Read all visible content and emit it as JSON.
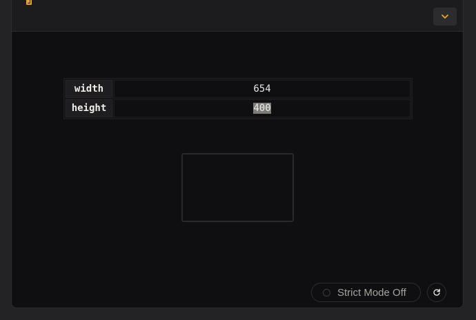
{
  "header": {
    "file_icon": "file-icon",
    "collapse_icon": "chevron-down-icon"
  },
  "props": [
    {
      "key": "width",
      "value": "654"
    },
    {
      "key": "height",
      "value": "400"
    }
  ],
  "footer": {
    "strict_mode_label": "Strict Mode Off",
    "refresh_icon": "refresh-icon"
  },
  "colors": {
    "accent": "#e4a72a",
    "panel_bg": "#0f0e10",
    "header_bg": "#1c1b1d",
    "selection": "#7d7b78"
  }
}
